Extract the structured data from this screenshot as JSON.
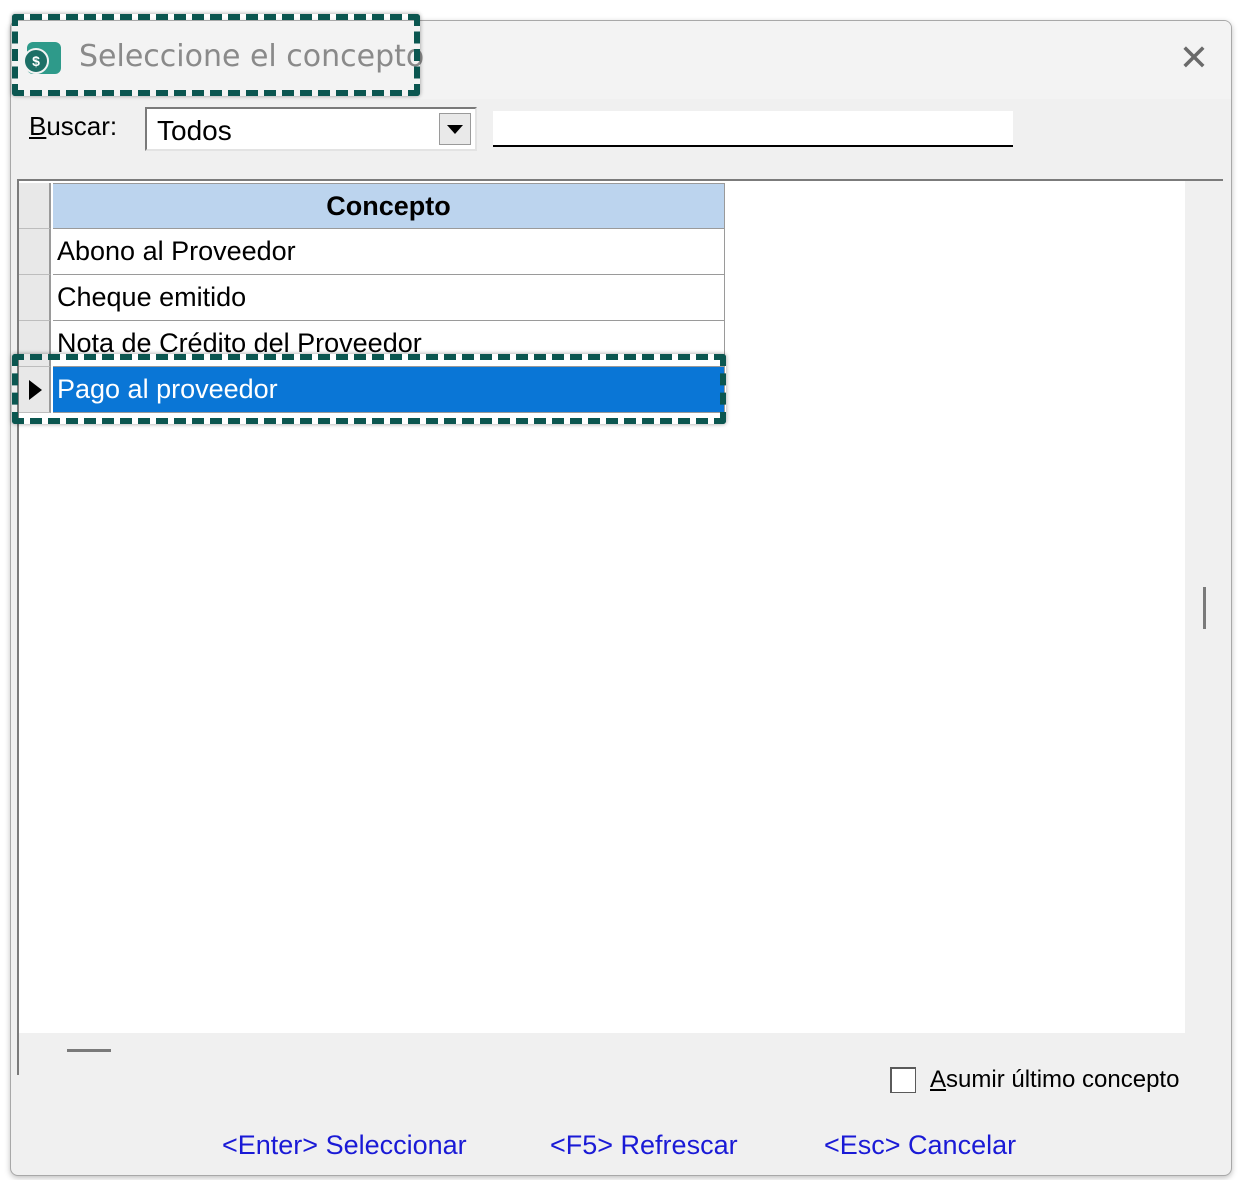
{
  "window": {
    "title": "Seleccione el concepto",
    "app_icon_glyph": "$",
    "close_glyph": "✕"
  },
  "search": {
    "label_mnemonic": "B",
    "label_rest": "uscar:",
    "combo_value": "Todos",
    "input_value": ""
  },
  "grid": {
    "column_header": "Concepto",
    "rows": [
      {
        "label": "Abono al Proveedor"
      },
      {
        "label": "Cheque emitido"
      },
      {
        "label": "Nota de Crédito del Proveedor"
      },
      {
        "label": "Pago al proveedor",
        "selected": true
      }
    ]
  },
  "footer": {
    "checkbox_mnemonic": "A",
    "checkbox_rest": "sumir último concepto",
    "checkbox_checked": false,
    "select_link": "<Enter> Seleccionar",
    "refresh_link": "<F5> Refrescar",
    "cancel_link": "<Esc> Cancelar"
  },
  "colors": {
    "highlight_border": "#0b5650",
    "header_bg": "#bcd4ee",
    "selected_row_bg": "#0a76d6",
    "link_color": "#1a1ad6"
  }
}
